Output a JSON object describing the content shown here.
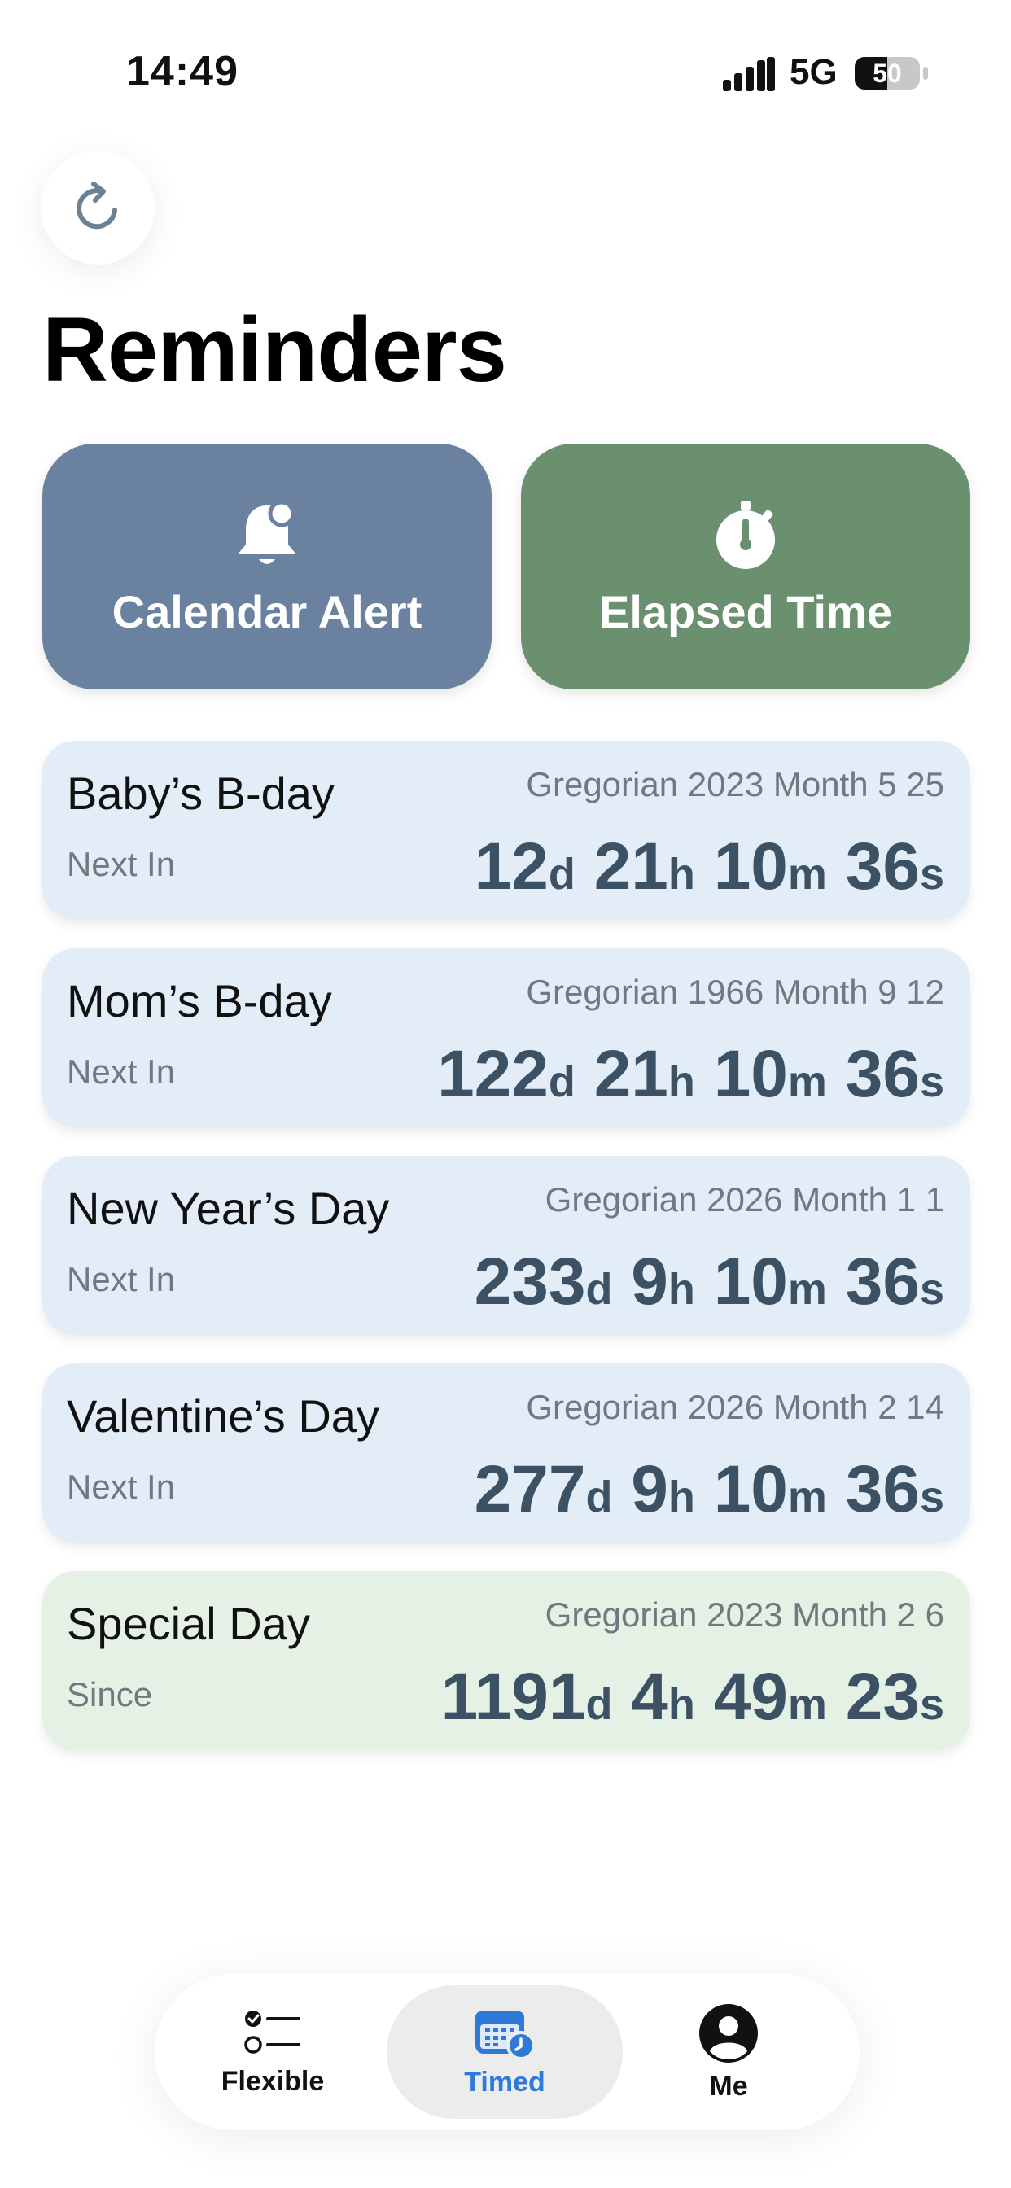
{
  "status_bar": {
    "time": "14:49",
    "network": "5G",
    "battery": "50",
    "battery_level": 0.5
  },
  "header": {
    "title": "Reminders",
    "refresh_icon": "refresh-icon"
  },
  "actions": [
    {
      "label": "Calendar Alert",
      "icon": "bell-icon",
      "color": "#6a82a0"
    },
    {
      "label": "Elapsed Time",
      "icon": "stopwatch-icon",
      "color": "#6b9070"
    }
  ],
  "colors": {
    "card_blue": "#e3edf8",
    "card_green": "#e4f1e4",
    "counter_text": "#3d5164",
    "accent": "#2f7ad8"
  },
  "reminders": [
    {
      "name": "Baby’s B-day",
      "date": "Gregorian 2023 Month 5 25",
      "status": "Next In",
      "days": "12",
      "hours": "21",
      "minutes": "10",
      "seconds": "36",
      "color": "#e3edf8"
    },
    {
      "name": "Mom’s B-day",
      "date": "Gregorian 1966 Month 9 12",
      "status": "Next In",
      "days": "122",
      "hours": "21",
      "minutes": "10",
      "seconds": "36",
      "color": "#e3edf8"
    },
    {
      "name": "New Year’s Day",
      "date": "Gregorian 2026 Month 1 1",
      "status": "Next In",
      "days": "233",
      "hours": "9",
      "minutes": "10",
      "seconds": "36",
      "color": "#e3edf8"
    },
    {
      "name": "Valentine’s Day",
      "date": "Gregorian 2026 Month 2 14",
      "status": "Next In",
      "days": "277",
      "hours": "9",
      "minutes": "10",
      "seconds": "36",
      "color": "#e3edf8"
    },
    {
      "name": "Special Day",
      "date": "Gregorian 2023 Month 2 6",
      "status": "Since",
      "days": "1191",
      "hours": "4",
      "minutes": "49",
      "seconds": "23",
      "color": "#e4f1e4"
    }
  ],
  "units": {
    "d": "d",
    "h": "h",
    "m": "m",
    "s": "s"
  },
  "tab_bar": {
    "tabs": [
      {
        "label": "Flexible",
        "icon": "checklist-icon"
      },
      {
        "label": "Timed",
        "icon": "calendar-clock-icon",
        "selected": true
      },
      {
        "label": "Me",
        "icon": "person-icon"
      }
    ]
  }
}
